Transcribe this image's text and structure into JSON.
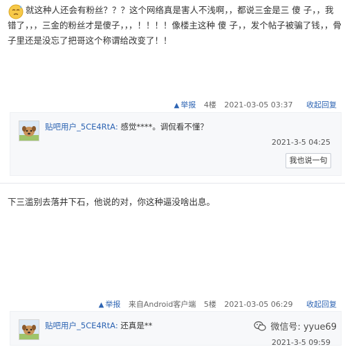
{
  "post1": {
    "text": "就这种人还会有粉丝？？？这个网络真是害人不浅啊，，都说三金是三 傻 子，，我错了，，，三金的粉丝才是傻子，，，！！！！像楼主这种 傻 子，，发个帖子被骗了钱，，骨子里还是没忘了把哥这个称谓给改变了！！",
    "report": "举报",
    "floor": "4楼",
    "time": "2021-03-05 03:37",
    "collapse": "收起回复",
    "comment": {
      "user": "贴吧用户_5CE4RtA:",
      "text": "感觉****。调侃看不懂？",
      "time": "2021-3-5 04:25",
      "reply_button": "我也说一句"
    }
  },
  "post2": {
    "text": "下三滥别去落井下石，他说的对，你这种逼没啥出息。",
    "report": "举报",
    "client": "来自Android客户端",
    "floor": "5楼",
    "time": "2021-03-05 06:29",
    "collapse": "收起回复",
    "comment": {
      "user": "贴吧用户_5CE4RtA:",
      "text": "还真是**",
      "time": "2021-3-5 09:59"
    }
  },
  "watermark": "微信号: yyue69"
}
